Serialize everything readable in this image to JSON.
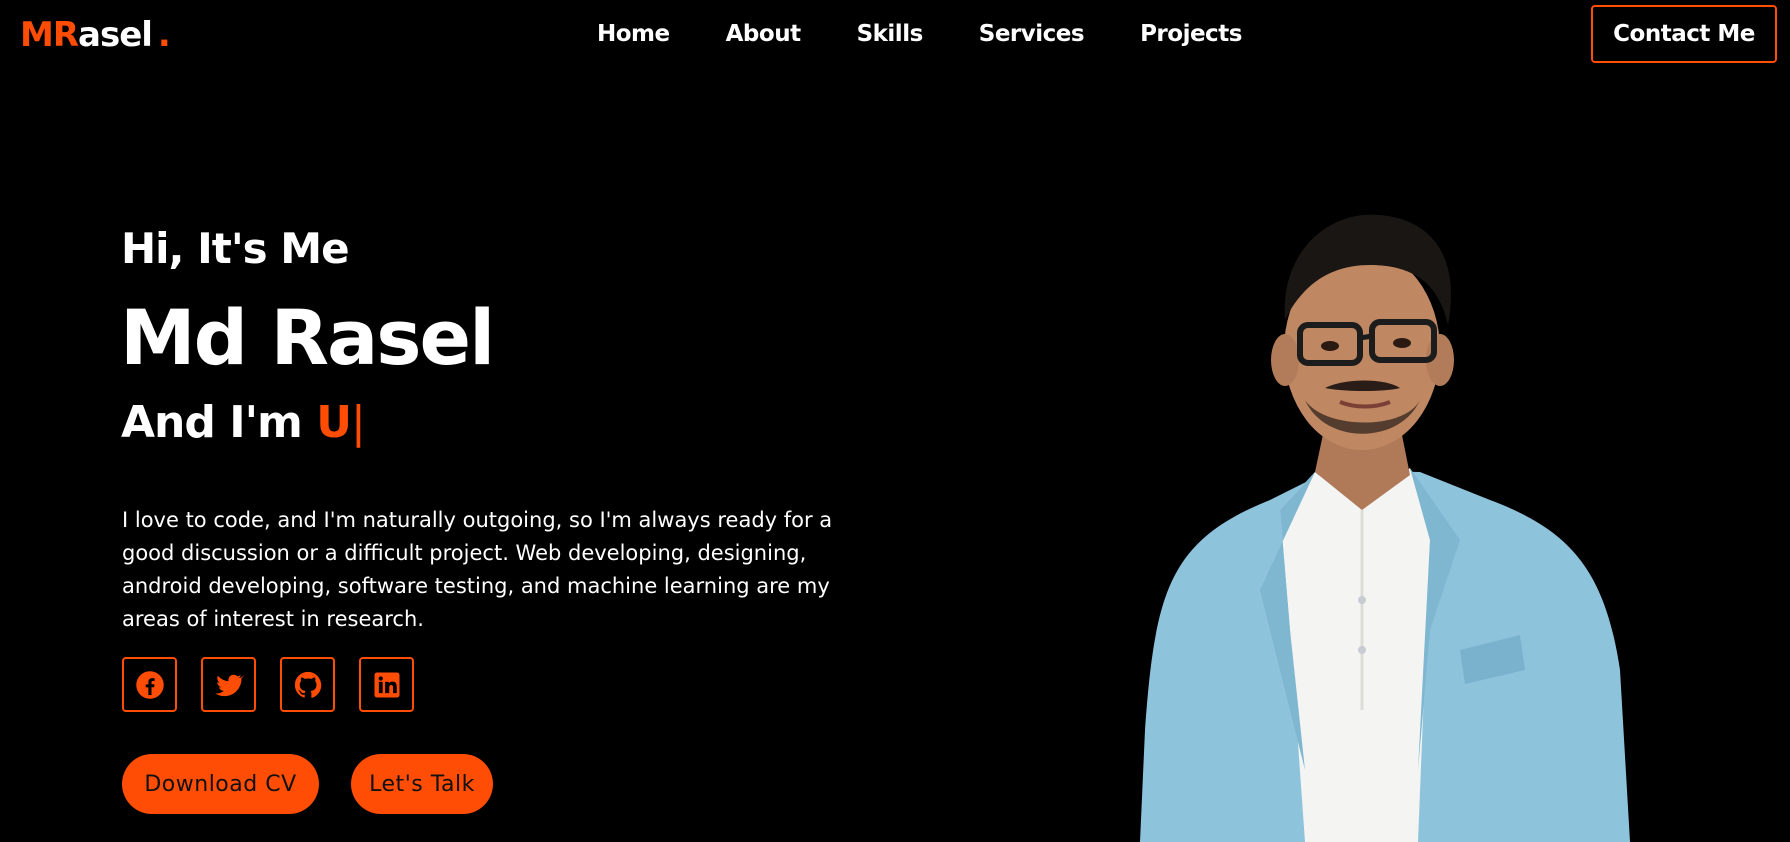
{
  "logo": {
    "accent": "MR",
    "rest": "asel",
    "dot": "."
  },
  "nav": {
    "items": [
      {
        "label": "Home"
      },
      {
        "label": "About"
      },
      {
        "label": "Skills"
      },
      {
        "label": "Services"
      },
      {
        "label": "Projects"
      }
    ]
  },
  "contact_button": "Contact Me",
  "hero": {
    "greeting": "Hi, It's Me",
    "name": "Md Rasel",
    "role_prefix": "And I'm",
    "role_typed": "U",
    "cursor": "|",
    "description": "I love to code, and I'm naturally outgoing, so I'm always ready for a good discussion or a difficult project. Web developing, designing, android developing, software testing, and machine learning are my areas of interest in research."
  },
  "socials": [
    {
      "icon": "facebook-icon"
    },
    {
      "icon": "twitter-icon"
    },
    {
      "icon": "github-icon"
    },
    {
      "icon": "linkedin-icon"
    }
  ],
  "buttons": {
    "download_cv": "Download CV",
    "lets_talk": "Let's Talk"
  },
  "colors": {
    "accent": "#ff4d05",
    "background": "#000000",
    "text": "#ffffff",
    "blazer": "#8ec3dc",
    "shirt": "#f4f4f2"
  }
}
